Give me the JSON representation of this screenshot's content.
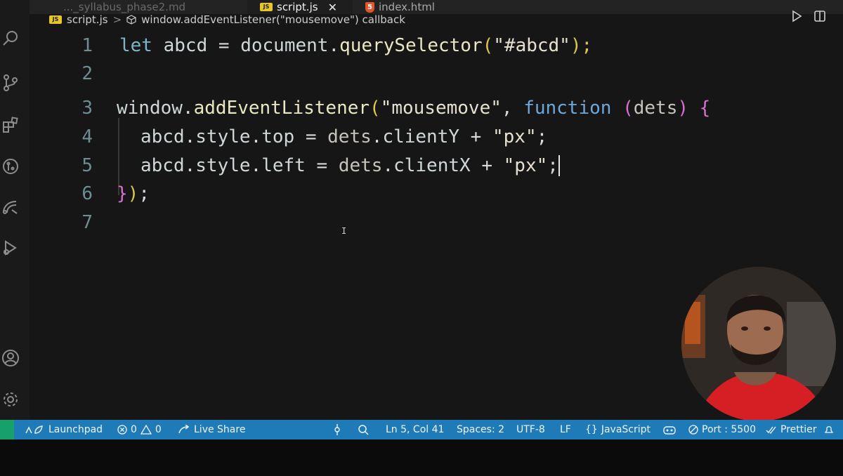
{
  "tabs": [
    {
      "label": "..._syllabus_phase2.md",
      "state": "faded"
    },
    {
      "label": "script.js",
      "badge": "JS",
      "state": "active"
    },
    {
      "label": "index.html",
      "badge": "5",
      "state": "inactive"
    }
  ],
  "tab_close_glyph": "✕",
  "breadcrumb": {
    "file": "script.js",
    "separator": ">",
    "symbol": "window.addEventListener(\"mousemove\") callback"
  },
  "editor_actions": [
    "run-icon",
    "split-editor-icon"
  ],
  "activity_icons": [
    "search-icon",
    "source-control-icon",
    "extensions-icon",
    "github-icon",
    "remote-explorer-icon",
    "run-debug-icon",
    "account-icon",
    "settings-gear-icon"
  ],
  "code": {
    "line_numbers": [
      "1",
      "2",
      "3",
      "4",
      "5",
      "6",
      "7"
    ],
    "l1": {
      "kw": "let",
      "var": "abcd",
      "eq": "=",
      "obj": "document",
      "dot": ".",
      "fn": "querySelector",
      "open": "(",
      "str": "\"#abcd\"",
      "close": ");"
    },
    "l3": {
      "obj": "window",
      "dot": ".",
      "fn": "addEventListener",
      "open": "(",
      "str": "\"mousemove\"",
      "comma": ",",
      "fnkw": "function",
      "popen": "(",
      "param": "dets",
      "pclose": ")",
      "brace": "{"
    },
    "l4": {
      "a": "abcd",
      "d1": ".",
      "b": "style",
      "d2": ".",
      "c": "top",
      "eq": "=",
      "o": "dets",
      "d3": ".",
      "p": "clientY",
      "plus": "+",
      "str": "\"px\"",
      "semi": ";"
    },
    "l5": {
      "a": "abcd",
      "d1": ".",
      "b": "style",
      "d2": ".",
      "c": "left",
      "eq": "=",
      "o": "dets",
      "d3": ".",
      "p": "clientX",
      "plus": "+",
      "str": "\"px\"",
      "semi": ";"
    },
    "l6": {
      "brace": "}",
      "paren": ")",
      "semi": ";"
    }
  },
  "colors": {
    "status_bar": "#1f7ab8",
    "remote_indicator": "#17a06a",
    "editor_bg": "#161616",
    "keyword": "#7fb3c6",
    "brace": "#e0c84a",
    "paren": "#d96fd1"
  },
  "status_bar": {
    "launchpad": "Launchpad",
    "errors": "0",
    "warnings": "0",
    "live_share": "Live Share",
    "position": "Ln 5, Col 41",
    "spaces": "Spaces: 2",
    "encoding": "UTF-8",
    "eol": "LF",
    "language_brace": "{}",
    "language": "JavaScript",
    "port": "Port : 5500",
    "prettier": "Prettier"
  }
}
